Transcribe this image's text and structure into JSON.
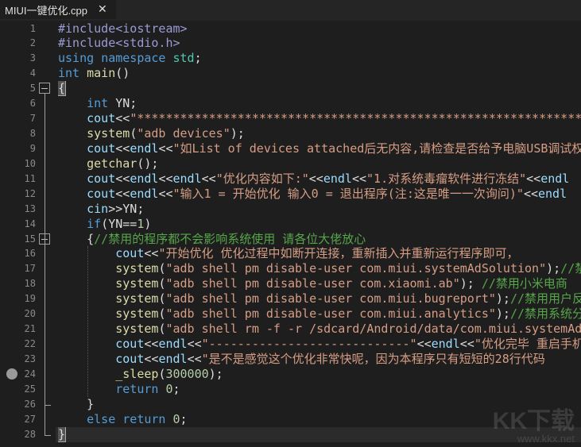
{
  "tab": {
    "title": "MIUI一键优化.cpp",
    "close_label": "✕"
  },
  "watermark": {
    "brand": "KK下载",
    "url": "www.kkx.net"
  },
  "breakpoint_line": 24,
  "current_line": 28,
  "fold_lines": [
    5,
    15
  ],
  "lines": [
    [
      [
        "pp",
        "#include<iostream>"
      ]
    ],
    [
      [
        "pp",
        "#include<stdio.h>"
      ]
    ],
    [
      [
        "kw",
        "using"
      ],
      [
        "op",
        " "
      ],
      [
        "kw",
        "namespace"
      ],
      [
        "op",
        " "
      ],
      [
        "ty",
        "std"
      ],
      [
        "op",
        ";"
      ]
    ],
    [
      [
        "kw",
        "int"
      ],
      [
        "op",
        " "
      ],
      [
        "fn",
        "main"
      ],
      [
        "op",
        "()"
      ]
    ],
    [
      [
        "br",
        "{"
      ]
    ],
    [
      [
        "op",
        "    "
      ],
      [
        "kw",
        "int"
      ],
      [
        "op",
        " "
      ],
      [
        "id",
        "YN;"
      ]
    ],
    [
      [
        "op",
        "    "
      ],
      [
        "io",
        "cout"
      ],
      [
        "op",
        "<<"
      ],
      [
        "str",
        "\"****************************************************************"
      ]
    ],
    [
      [
        "op",
        "    "
      ],
      [
        "fn",
        "system"
      ],
      [
        "op",
        "("
      ],
      [
        "str",
        "\"adb devices\""
      ],
      [
        "op",
        ");"
      ]
    ],
    [
      [
        "op",
        "    "
      ],
      [
        "io",
        "cout"
      ],
      [
        "op",
        "<<"
      ],
      [
        "io",
        "endl"
      ],
      [
        "op",
        "<<"
      ],
      [
        "str",
        "\"如List of devices attached后无内容,请检查是否给予电脑USB调试权限"
      ]
    ],
    [
      [
        "op",
        "    "
      ],
      [
        "fn",
        "getchar"
      ],
      [
        "op",
        "();"
      ]
    ],
    [
      [
        "op",
        "    "
      ],
      [
        "io",
        "cout"
      ],
      [
        "op",
        "<<"
      ],
      [
        "io",
        "endl"
      ],
      [
        "op",
        "<<"
      ],
      [
        "io",
        "endl"
      ],
      [
        "op",
        "<<"
      ],
      [
        "str",
        "\"优化内容如下:\""
      ],
      [
        "op",
        "<<"
      ],
      [
        "io",
        "endl"
      ],
      [
        "op",
        "<<"
      ],
      [
        "str",
        "\"1.对系统毒瘤软件进行冻结\""
      ],
      [
        "op",
        "<<"
      ],
      [
        "io",
        "endl"
      ]
    ],
    [
      [
        "op",
        "    "
      ],
      [
        "io",
        "cout"
      ],
      [
        "op",
        "<<"
      ],
      [
        "io",
        "endl"
      ],
      [
        "op",
        "<<"
      ],
      [
        "str",
        "\"输入1 = 开始优化 输入0 = 退出程序(注:这是唯一一次询问)\""
      ],
      [
        "op",
        "<<"
      ],
      [
        "io",
        "endl"
      ]
    ],
    [
      [
        "op",
        "    "
      ],
      [
        "io",
        "cin"
      ],
      [
        "op",
        ">>"
      ],
      [
        "id",
        "YN;"
      ]
    ],
    [
      [
        "op",
        "    "
      ],
      [
        "kw",
        "if"
      ],
      [
        "op",
        "("
      ],
      [
        "id",
        "YN"
      ],
      [
        "op",
        "=="
      ],
      [
        "num",
        "1"
      ],
      [
        "op",
        ")"
      ]
    ],
    [
      [
        "op",
        "    "
      ],
      [
        "br",
        "{"
      ],
      [
        "cm",
        "//禁用的程序都不会影响系统使用 请各位大佬放心"
      ]
    ],
    [
      [
        "op",
        "        "
      ],
      [
        "io",
        "cout"
      ],
      [
        "op",
        "<<"
      ],
      [
        "str",
        "\"开始优化 优化过程中如断开连接，重新插入并重新运行程序即可，"
      ]
    ],
    [
      [
        "op",
        "        "
      ],
      [
        "fn",
        "system"
      ],
      [
        "op",
        "("
      ],
      [
        "str",
        "\"adb shell pm disable-user com.miui.systemAdSolution\""
      ],
      [
        "op",
        ");"
      ],
      [
        "cm",
        "//禁用广告"
      ]
    ],
    [
      [
        "op",
        "        "
      ],
      [
        "fn",
        "system"
      ],
      [
        "op",
        "("
      ],
      [
        "str",
        "\"adb shell pm disable-user com.xiaomi.ab\""
      ],
      [
        "op",
        "); "
      ],
      [
        "cm",
        "//禁用小米电商"
      ]
    ],
    [
      [
        "op",
        "        "
      ],
      [
        "fn",
        "system"
      ],
      [
        "op",
        "("
      ],
      [
        "str",
        "\"adb shell pm disable-user com.miui.bugreport\""
      ],
      [
        "op",
        ");"
      ],
      [
        "cm",
        "//禁用用户反馈"
      ]
    ],
    [
      [
        "op",
        "        "
      ],
      [
        "fn",
        "system"
      ],
      [
        "op",
        "("
      ],
      [
        "str",
        "\"adb shell pm disable-user com.miui.analytics\""
      ],
      [
        "op",
        ");"
      ],
      [
        "cm",
        "//禁用系统分析"
      ]
    ],
    [
      [
        "op",
        "        "
      ],
      [
        "fn",
        "system"
      ],
      [
        "op",
        "("
      ],
      [
        "str",
        "\"adb shell rm -f -r /sdcard/Android/data/com.miui.systemAdSolution"
      ]
    ],
    [
      [
        "op",
        "        "
      ],
      [
        "io",
        "cout"
      ],
      [
        "op",
        "<<"
      ],
      [
        "io",
        "endl"
      ],
      [
        "op",
        "<<"
      ],
      [
        "str",
        "\"----------------------------\""
      ],
      [
        "op",
        "<<"
      ],
      [
        "io",
        "endl"
      ],
      [
        "op",
        "<<"
      ],
      [
        "str",
        "\"优化完毕 重启手机"
      ]
    ],
    [
      [
        "op",
        "        "
      ],
      [
        "io",
        "cout"
      ],
      [
        "op",
        "<<"
      ],
      [
        "io",
        "endl"
      ],
      [
        "op",
        "<<"
      ],
      [
        "str",
        "\"是不是感觉这个优化非常快呢，因为本程序只有短短的28行代码"
      ]
    ],
    [
      [
        "op",
        "        "
      ],
      [
        "fn",
        "_sleep"
      ],
      [
        "op",
        "("
      ],
      [
        "num",
        "300000"
      ],
      [
        "op",
        ");"
      ]
    ],
    [
      [
        "op",
        "        "
      ],
      [
        "kw",
        "return"
      ],
      [
        "op",
        " "
      ],
      [
        "num",
        "0"
      ],
      [
        "op",
        ";"
      ]
    ],
    [
      [
        "op",
        "    "
      ],
      [
        "br",
        "}"
      ]
    ],
    [
      [
        "op",
        "    "
      ],
      [
        "kw",
        "else"
      ],
      [
        "op",
        " "
      ],
      [
        "kw",
        "return"
      ],
      [
        "op",
        " "
      ],
      [
        "num",
        "0"
      ],
      [
        "op",
        ";"
      ]
    ],
    [
      [
        "br",
        "}"
      ]
    ]
  ]
}
